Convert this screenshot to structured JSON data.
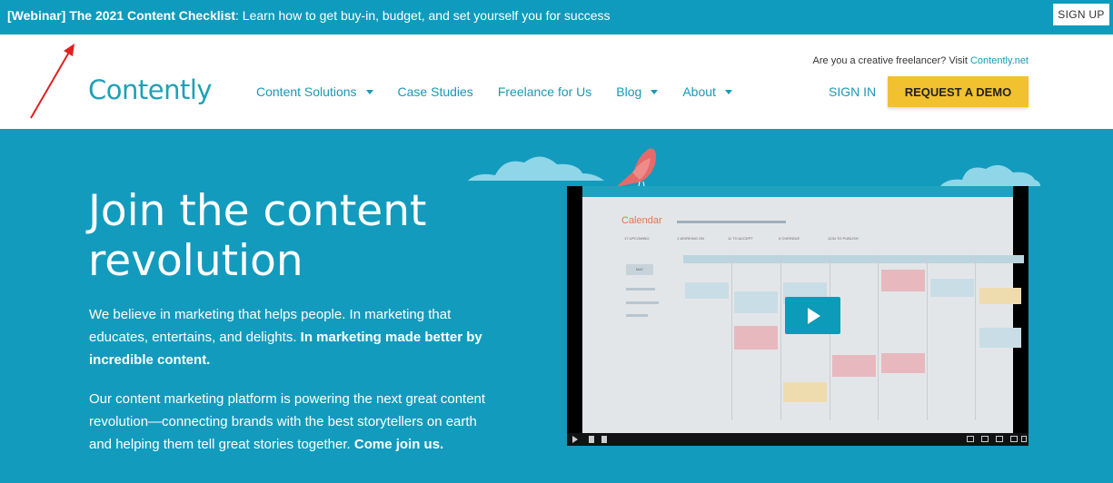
{
  "topbar": {
    "bold": "[Webinar] The 2021 Content Checklist",
    "text": ": Learn how to get buy-in, budget, and set yourself you for success",
    "signup_label": "SIGN UP"
  },
  "header": {
    "logo": "Contently",
    "freelancer_prompt": "Are you a creative freelancer? Visit ",
    "freelancer_link": "Contently.net",
    "nav": [
      "Content Solutions",
      "Case Studies",
      "Freelance for Us",
      "Blog",
      "About"
    ],
    "signin_label": "SIGN IN",
    "demo_label": "REQUEST A DEMO"
  },
  "hero": {
    "title": "Join the content revolution",
    "p1_text": "We believe in marketing that helps people. In marketing that educates, entertains, and delights. ",
    "p1_bold": "In marketing made better by incredible content.",
    "p2_text": "Our content marketing platform is powering the next great content revolution—connecting brands with the best storytellers on earth and helping them tell great stories together. ",
    "p2_bold": "Come join us."
  },
  "video": {
    "calendar_title": "Calendar",
    "stats": [
      "17 UPCOMING",
      "1 WORKING ON",
      "11 TO ACCEPT",
      "5 OVERDUE",
      "1234 TO PUBLISH"
    ],
    "sidebar_tab": "MAY"
  },
  "colors": {
    "brand": "#139bbd",
    "accent": "#f1c12f",
    "link": "#1a98b5"
  },
  "icons": [
    "play-icon",
    "chevron-down-icon",
    "arrow-annotation"
  ]
}
